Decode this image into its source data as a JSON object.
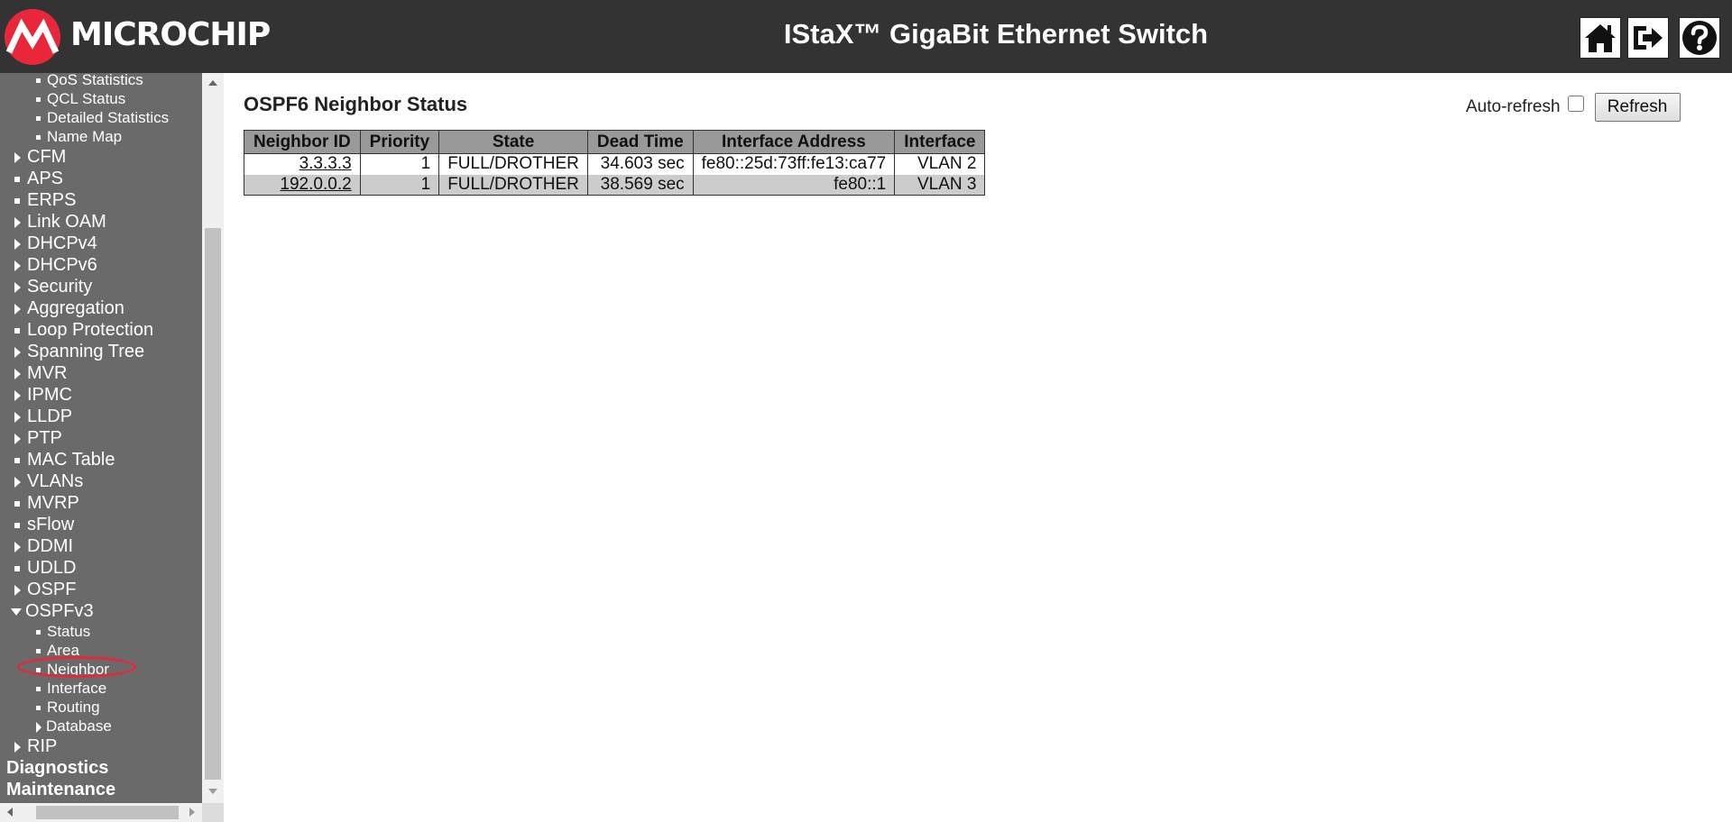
{
  "header": {
    "logo_text": "MICROCHIP",
    "title": "IStaX™ GigaBit Ethernet Switch",
    "buttons": [
      {
        "name": "home",
        "icon": "home-icon"
      },
      {
        "name": "logout",
        "icon": "logout-icon"
      },
      {
        "name": "help",
        "icon": "help-icon"
      }
    ]
  },
  "sidebar": {
    "items": [
      {
        "label": "QoS Statistics",
        "level": 2,
        "marker": "square"
      },
      {
        "label": "QCL Status",
        "level": 2,
        "marker": "square"
      },
      {
        "label": "Detailed Statistics",
        "level": 2,
        "marker": "square"
      },
      {
        "label": "Name Map",
        "level": 2,
        "marker": "square"
      },
      {
        "label": "CFM",
        "level": 1,
        "marker": "collapsed"
      },
      {
        "label": "APS",
        "level": 1,
        "marker": "square"
      },
      {
        "label": "ERPS",
        "level": 1,
        "marker": "square"
      },
      {
        "label": "Link OAM",
        "level": 1,
        "marker": "collapsed"
      },
      {
        "label": "DHCPv4",
        "level": 1,
        "marker": "collapsed"
      },
      {
        "label": "DHCPv6",
        "level": 1,
        "marker": "collapsed"
      },
      {
        "label": "Security",
        "level": 1,
        "marker": "collapsed"
      },
      {
        "label": "Aggregation",
        "level": 1,
        "marker": "collapsed"
      },
      {
        "label": "Loop Protection",
        "level": 1,
        "marker": "square"
      },
      {
        "label": "Spanning Tree",
        "level": 1,
        "marker": "collapsed"
      },
      {
        "label": "MVR",
        "level": 1,
        "marker": "collapsed"
      },
      {
        "label": "IPMC",
        "level": 1,
        "marker": "collapsed"
      },
      {
        "label": "LLDP",
        "level": 1,
        "marker": "collapsed"
      },
      {
        "label": "PTP",
        "level": 1,
        "marker": "collapsed"
      },
      {
        "label": "MAC Table",
        "level": 1,
        "marker": "square"
      },
      {
        "label": "VLANs",
        "level": 1,
        "marker": "collapsed"
      },
      {
        "label": "MVRP",
        "level": 1,
        "marker": "square"
      },
      {
        "label": "sFlow",
        "level": 1,
        "marker": "square"
      },
      {
        "label": "DDMI",
        "level": 1,
        "marker": "collapsed"
      },
      {
        "label": "UDLD",
        "level": 1,
        "marker": "square"
      },
      {
        "label": "OSPF",
        "level": 1,
        "marker": "collapsed"
      },
      {
        "label": "OSPFv3",
        "level": 1,
        "marker": "expanded"
      },
      {
        "label": "Status",
        "level": 2,
        "marker": "square"
      },
      {
        "label": "Area",
        "level": 2,
        "marker": "square"
      },
      {
        "label": "Neighbor",
        "level": 2,
        "marker": "square",
        "selected": true
      },
      {
        "label": "Interface",
        "level": 2,
        "marker": "square"
      },
      {
        "label": "Routing",
        "level": 2,
        "marker": "square"
      },
      {
        "label": "Database",
        "level": 2,
        "marker": "collapsed"
      },
      {
        "label": "RIP",
        "level": 1,
        "marker": "collapsed"
      },
      {
        "label": "Diagnostics",
        "level": 0,
        "marker": "none"
      },
      {
        "label": "Maintenance",
        "level": 0,
        "marker": "none"
      }
    ]
  },
  "main": {
    "page_title": "OSPF6 Neighbor Status",
    "auto_refresh_label": "Auto-refresh",
    "auto_refresh_checked": false,
    "refresh_button": "Refresh",
    "table": {
      "headers": [
        "Neighbor ID",
        "Priority",
        "State",
        "Dead Time",
        "Interface Address",
        "Interface"
      ],
      "rows": [
        [
          "3.3.3.3",
          "1",
          "FULL/DROTHER",
          "34.603 sec",
          "fe80::25d:73ff:fe13:ca77",
          "VLAN 2"
        ],
        [
          "192.0.0.2",
          "1",
          "FULL/DROTHER",
          "38.569 sec",
          "fe80::1",
          "VLAN 3"
        ]
      ]
    }
  },
  "colors": {
    "header_bg": "#333333",
    "sidebar_bg": "#6a6a6a",
    "table_header_bg": "#999999",
    "row_alt_bg": "#cccccc",
    "highlight": "#e8283a",
    "logo_red": "#e8283a"
  }
}
